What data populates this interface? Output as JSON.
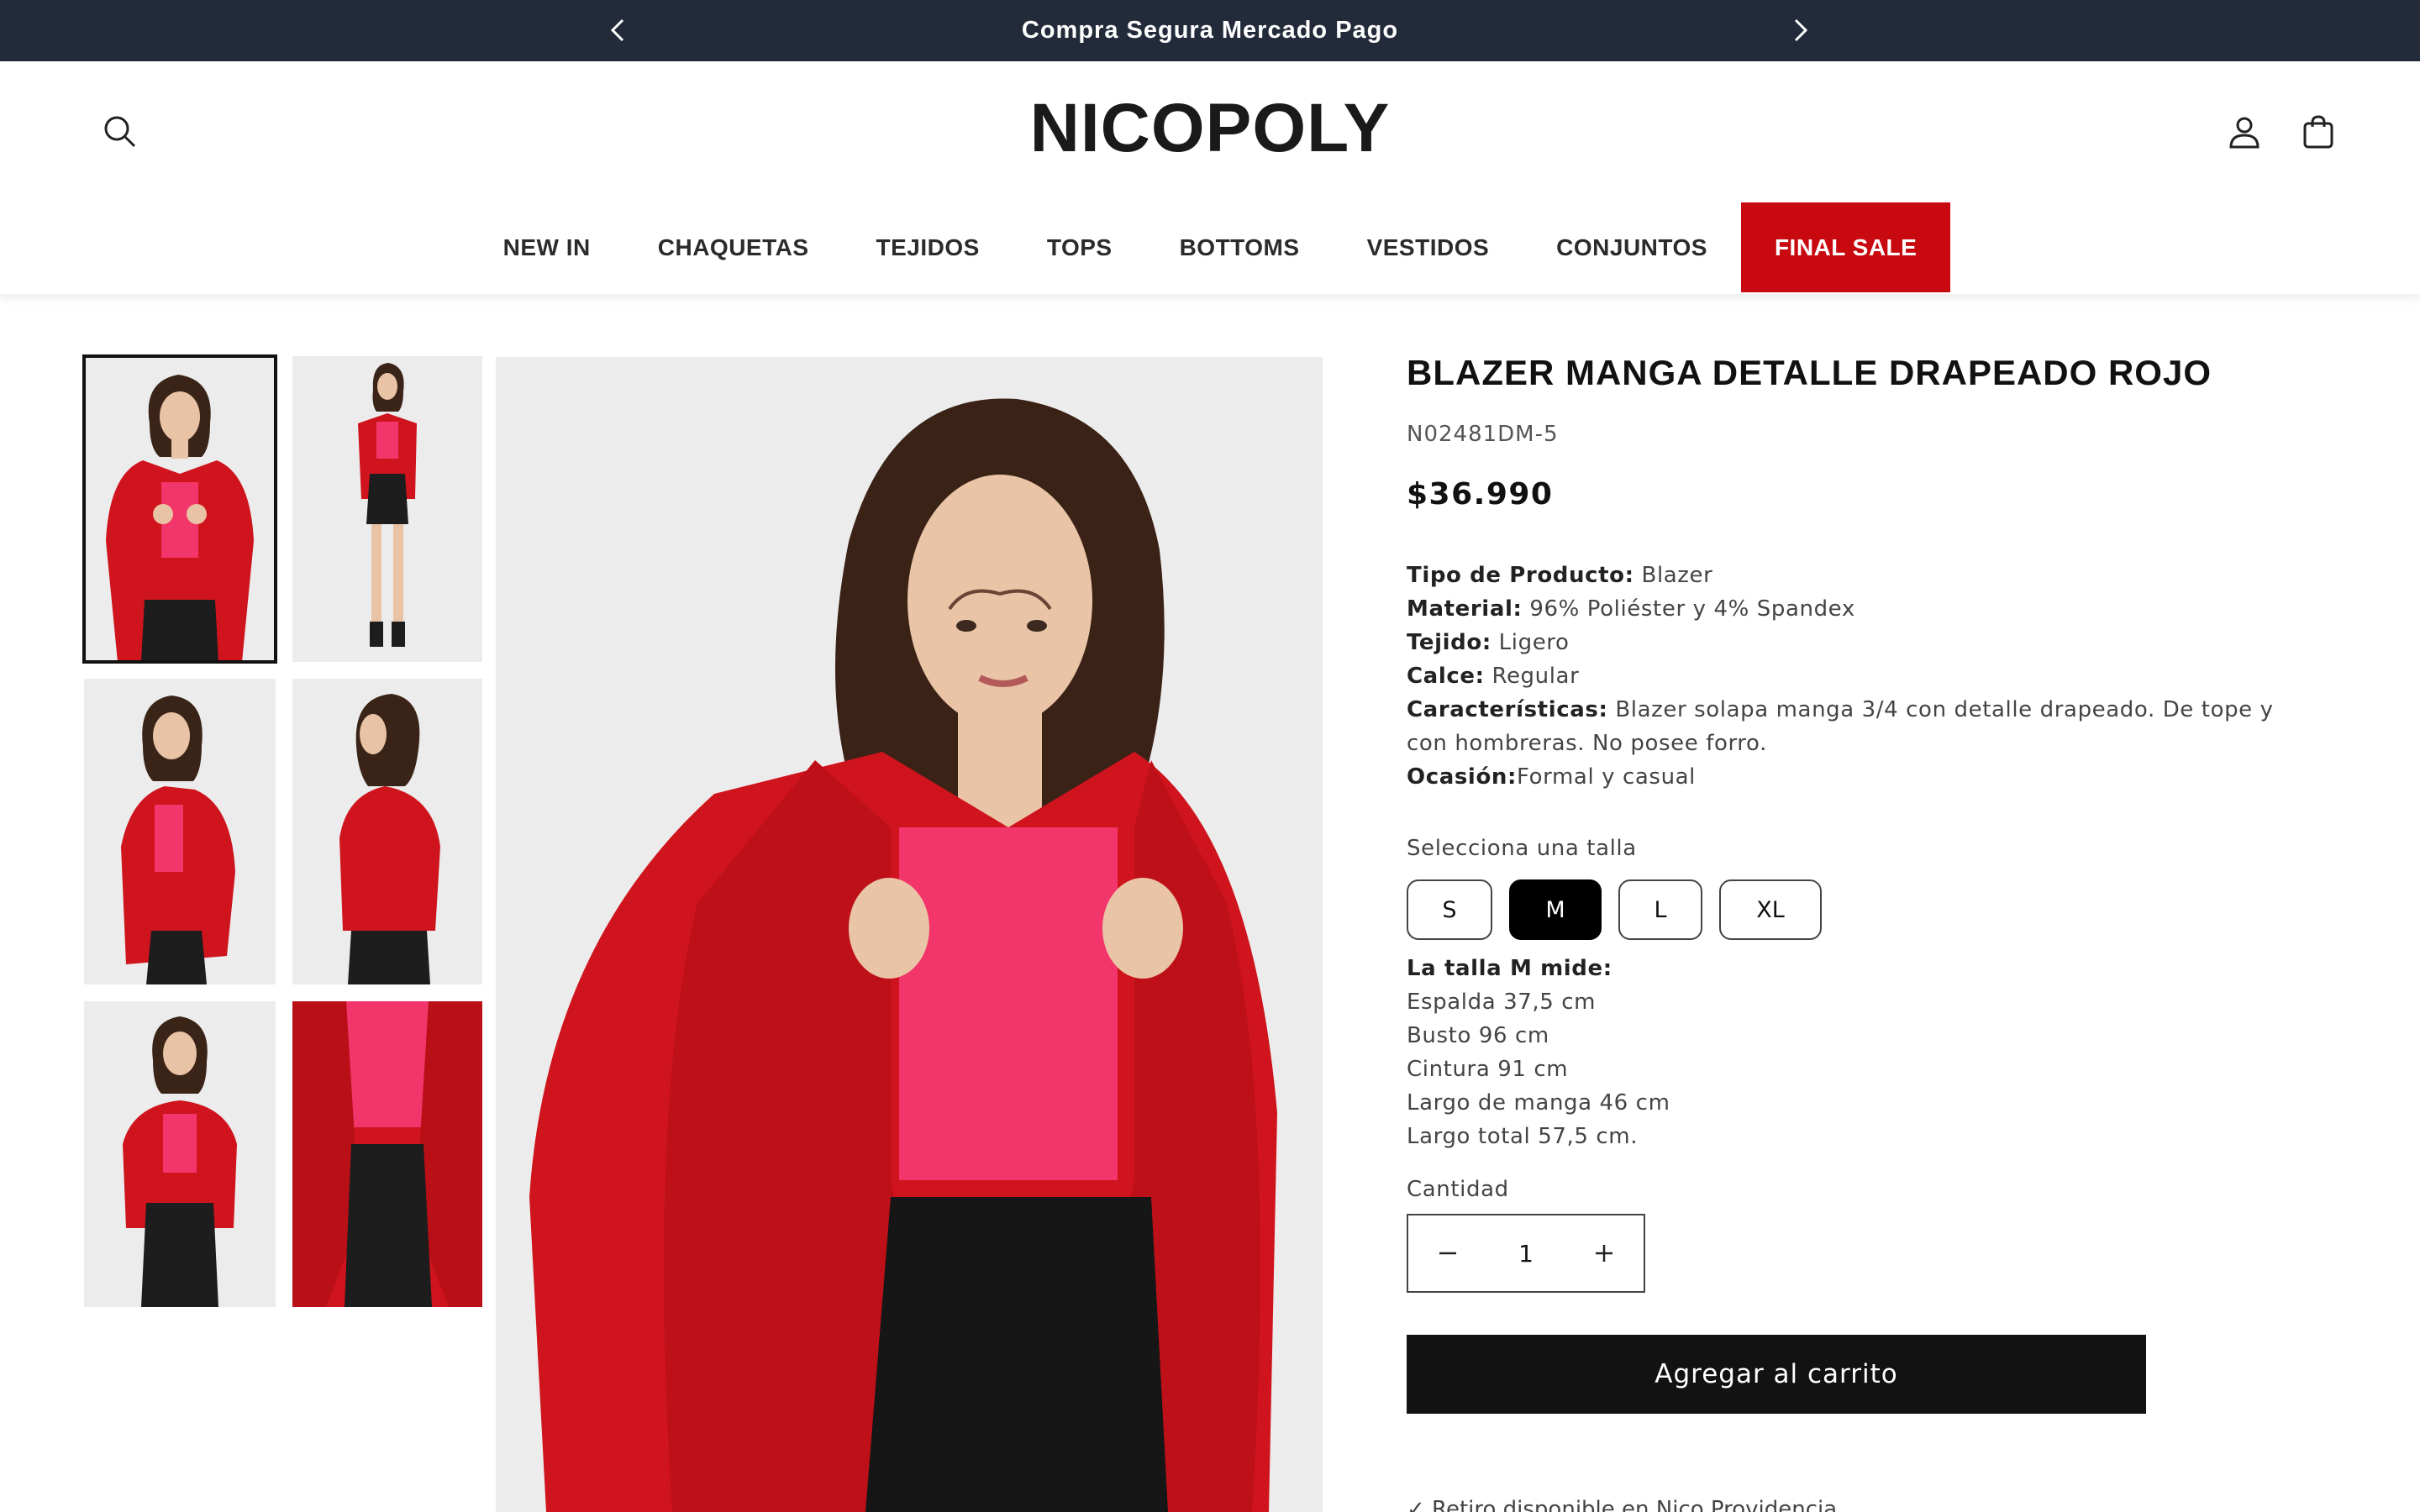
{
  "announcement": {
    "text": "Compra Segura Mercado Pago"
  },
  "header": {
    "logo": "NICOPOLY",
    "nav": [
      "NEW IN",
      "CHAQUETAS",
      "TEJIDOS",
      "TOPS",
      "BOTTOMS",
      "VESTIDOS",
      "CONJUNTOS",
      "FINAL SALE"
    ],
    "sale_color": "#c8090f"
  },
  "product": {
    "title": "BLAZER MANGA DETALLE DRAPEADO ROJO",
    "sku": "N02481DM-5",
    "price": "$36.990",
    "details": [
      {
        "label": "Tipo de Producto:",
        "value": " Blazer"
      },
      {
        "label": "Material:",
        "value": " 96% Poliéster y 4% Spandex"
      },
      {
        "label": "Tejido:",
        "value": " Ligero"
      },
      {
        "label": "Calce:",
        "value": " Regular"
      },
      {
        "label": "Características:",
        "value": " Blazer solapa manga 3/4 con detalle drapeado. De tope y con hombreras. No posee forro."
      },
      {
        "label": "Ocasión:",
        "value": "Formal y casual"
      }
    ],
    "size_label": "Selecciona una talla",
    "sizes": [
      "S",
      "M",
      "L",
      "XL"
    ],
    "selected_size": "M",
    "measure_title": "La talla M mide:",
    "measures": [
      "Espalda 37,5 cm",
      "Busto 96 cm",
      "Cintura 91 cm",
      "Largo de manga 46 cm",
      "Largo total 57,5 cm."
    ],
    "quantity_label": "Cantidad",
    "quantity": "1",
    "add_to_cart": "Agregar al carrito",
    "pickup_text": "✓ Retiro disponible en Nico Providencia",
    "color_primary": "#d0141d",
    "color_top": "#f2356a"
  }
}
